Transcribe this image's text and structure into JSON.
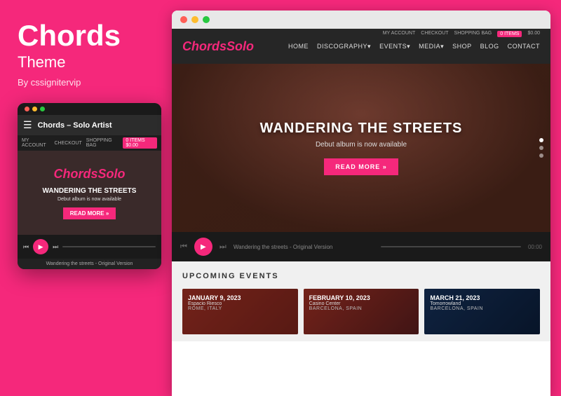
{
  "left": {
    "title": "Chords",
    "subtitle": "Theme",
    "author": "By cssignitervip"
  },
  "mobile": {
    "dots": [
      "red",
      "yellow",
      "green"
    ],
    "nav_title": "Chords – Solo Artist",
    "account_links": [
      "MY ACCOUNT",
      "CHECKOUT",
      "SHOPPING BAG"
    ],
    "cart": "0 ITEMS  $0.00",
    "logo_text": "Chords",
    "logo_accent": "Solo",
    "hero_title": "WANDERING THE STREETS",
    "hero_sub": "Debut album is now available",
    "read_more": "READ MORE »",
    "player_track": "Wandering the streets - Original Version"
  },
  "browser": {
    "dots": [
      "red",
      "yellow",
      "green"
    ],
    "header": {
      "logo": "Chords",
      "logo_accent": "Solo",
      "nav_items": [
        "HOME",
        "DISCOGRAPHY▾",
        "EVENTS▾",
        "MEDIA▾",
        "SHOP",
        "BLOG",
        "CONTACT"
      ],
      "account_links": [
        "MY ACCOUNT",
        "CHECKOUT",
        "SHOPPING BAG",
        "0 ITEMS",
        "$0.00"
      ]
    },
    "hero": {
      "title": "WANDERING THE STREETS",
      "subtitle": "Debut album is now available",
      "cta": "READ MORE »"
    },
    "player": {
      "track": "Wandering the streets - Original Version",
      "time": "00:00"
    },
    "events": {
      "section_title": "UPCOMING EVENTS",
      "cards": [
        {
          "date": "JANUARY 9, 2023",
          "venue": "Espacio Riesco",
          "location": "ROME, ITALY"
        },
        {
          "date": "FEBRUARY 10, 2023",
          "venue": "Casino Center",
          "location": "BARCELONA, SPAIN"
        },
        {
          "date": "MARCH 21, 2023",
          "venue": "Tomorrowland",
          "location": "BARCELONA, SPAIN"
        }
      ]
    }
  }
}
